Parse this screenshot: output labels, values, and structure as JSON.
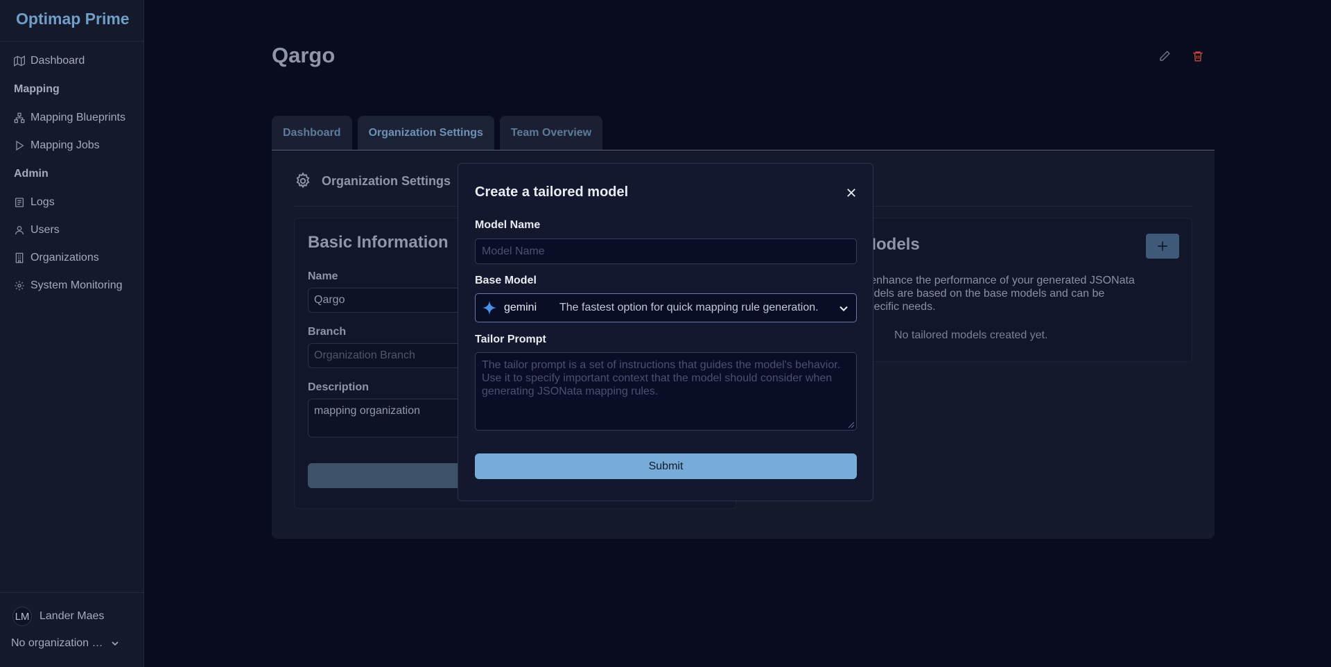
{
  "app": {
    "brand": "Optimap Prime"
  },
  "sidebar": {
    "items": [
      {
        "label": "Dashboard",
        "icon": "map-icon"
      },
      {
        "section": "Mapping"
      },
      {
        "label": "Mapping Blueprints",
        "icon": "network-icon"
      },
      {
        "label": "Mapping Jobs",
        "icon": "play-icon"
      },
      {
        "section": "Admin"
      },
      {
        "label": "Logs",
        "icon": "file-text-icon"
      },
      {
        "label": "Users",
        "icon": "user-icon"
      },
      {
        "label": "Organizations",
        "icon": "building-icon"
      },
      {
        "label": "System Monitoring",
        "icon": "gear-icon"
      }
    ],
    "user": {
      "initials": "LM",
      "name": "Lander Maes"
    },
    "org_selector": "No organization selected"
  },
  "page": {
    "title": "Qargo",
    "tabs": [
      "Dashboard",
      "Organization Settings",
      "Team Overview"
    ],
    "active_tab": "Organization Settings"
  },
  "settings": {
    "title": "Organization Settings",
    "basic_info": {
      "title": "Basic Information",
      "name_label": "Name",
      "name_value": "Qargo",
      "branch_label": "Branch",
      "branch_placeholder": "Organization Branch",
      "description_label": "Description",
      "description_value": "mapping organization"
    },
    "tailored_models": {
      "title_visible": "e Models",
      "desc_line1": "s to enhance the performance of your generated JSONata",
      "desc_line2": "d models are based on the base models and can be",
      "desc_line3": "ur specific needs.",
      "empty": "No tailored models created yet."
    }
  },
  "modal": {
    "title": "Create a tailored model",
    "model_name_label": "Model Name",
    "model_name_placeholder": "Model Name",
    "base_model_label": "Base Model",
    "base_model_value": "gemini",
    "base_model_description": "The fastest option for quick mapping rule generation.",
    "tailor_prompt_label": "Tailor Prompt",
    "tailor_prompt_placeholder": "The tailor prompt is a set of instructions that guides the model's behavior. Use it to specify important context that the model should consider when generating JSONata mapping rules.",
    "submit_label": "Submit"
  },
  "colors": {
    "accent": "#78acd8",
    "brand": "#6f9fc9",
    "delete": "#b84a33"
  }
}
